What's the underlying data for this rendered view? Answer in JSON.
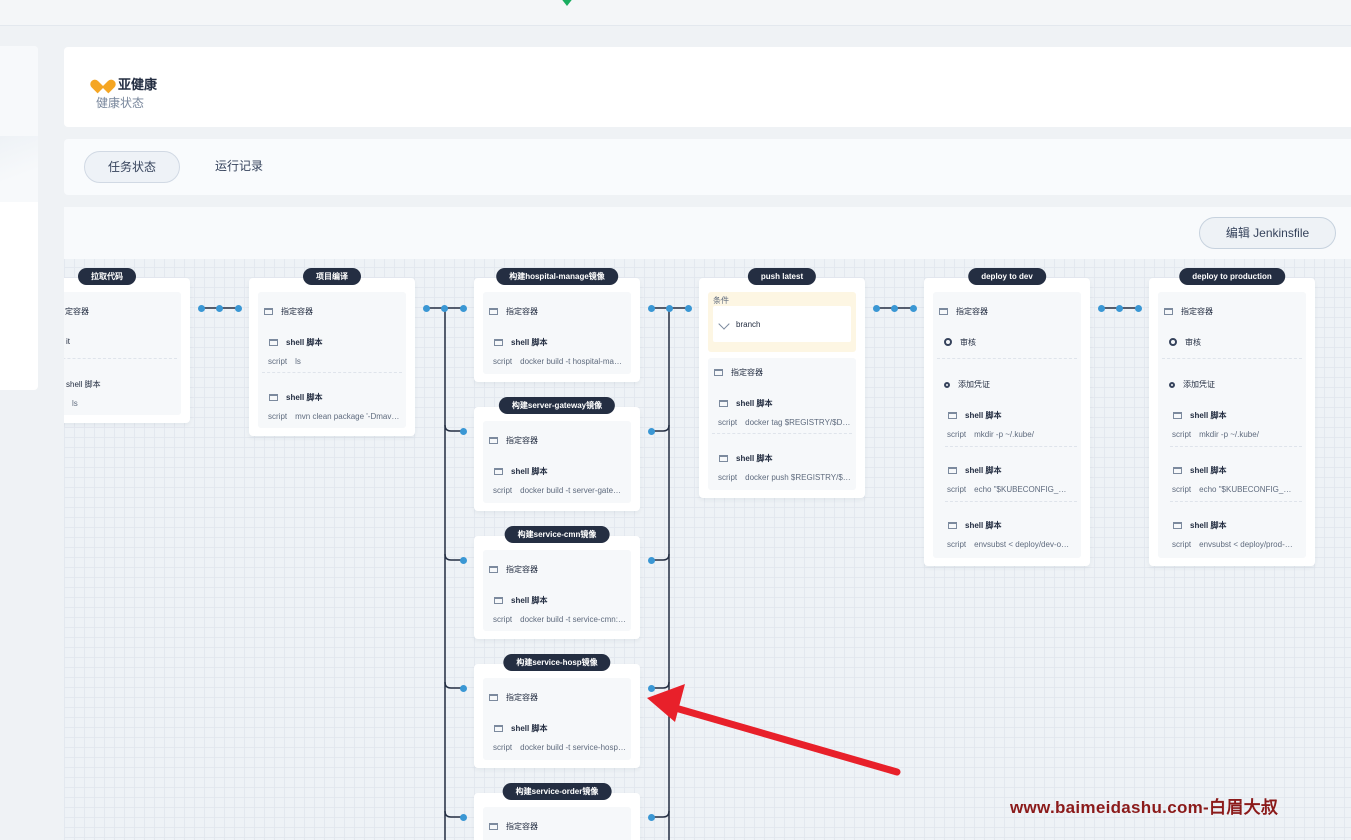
{
  "header": {
    "status_title": "亚健康",
    "status_subtitle": "健康状态"
  },
  "tabs": [
    {
      "label": "任务状态",
      "active": true
    },
    {
      "label": "运行记录",
      "active": false
    }
  ],
  "toolbar": {
    "edit_label": "编辑 Jenkinsfile"
  },
  "stages": {
    "checkout": {
      "title": "拉取代码",
      "container": "定容器",
      "step1": "it",
      "step2": "shell 脚本",
      "script2": "ls"
    },
    "compile": {
      "title": "项目编译",
      "container": "指定容器",
      "shell_label": "shell 脚本",
      "script_key": "script",
      "script1": "ls",
      "script2": "mvn clean package '-Dmav…"
    },
    "build_manage": {
      "title": "构建hospital-manage镜像",
      "container": "指定容器",
      "shell_label": "shell 脚本",
      "script_key": "script",
      "script": "docker build -t hospital-ma…"
    },
    "build_gateway": {
      "title": "构建server-gateway镜像",
      "container": "指定容器",
      "shell_label": "shell 脚本",
      "script_key": "script",
      "script": "docker build -t server-gate…"
    },
    "build_cmn": {
      "title": "构建service-cmn镜像",
      "container": "指定容器",
      "shell_label": "shell 脚本",
      "script_key": "script",
      "script": "docker build -t service-cmn:…"
    },
    "build_hosp": {
      "title": "构建service-hosp镜像",
      "container": "指定容器",
      "shell_label": "shell 脚本",
      "script_key": "script",
      "script": "docker build -t service-hosp…"
    },
    "build_order": {
      "title": "构建service-order镜像",
      "container": "指定容器"
    },
    "push_latest": {
      "title": "push latest",
      "condition_label": "条件",
      "branch": "branch",
      "container": "指定容器",
      "shell_label": "shell 脚本",
      "script_key": "script",
      "script1": "docker tag $REGISTRY/$D…",
      "script2": "docker push $REGISTRY/$…"
    },
    "deploy_dev": {
      "title": "deploy to dev",
      "container": "指定容器",
      "review": "审核",
      "credential": "添加凭证",
      "shell_label": "shell 脚本",
      "script_key": "script",
      "script1": "mkdir -p ~/.kube/",
      "script2": "echo \"$KUBECONFIG_…",
      "script3": "envsubst < deploy/dev-o…"
    },
    "deploy_prod": {
      "title": "deploy to production",
      "container": "指定容器",
      "review": "审核",
      "credential": "添加凭证",
      "shell_label": "shell 脚本",
      "script_key": "script",
      "script1": "mkdir -p ~/.kube/",
      "script2": "echo \"$KUBECONFIG_…",
      "script3": "envsubst < deploy/prod-…"
    }
  },
  "watermark": "www.baimeidashu.com-白眉大叔",
  "colors": {
    "stage_title_bg": "#242e42",
    "connector": "#3a97d4",
    "annotation_arrow": "#e8202a",
    "status_icon": "#f5a623"
  }
}
